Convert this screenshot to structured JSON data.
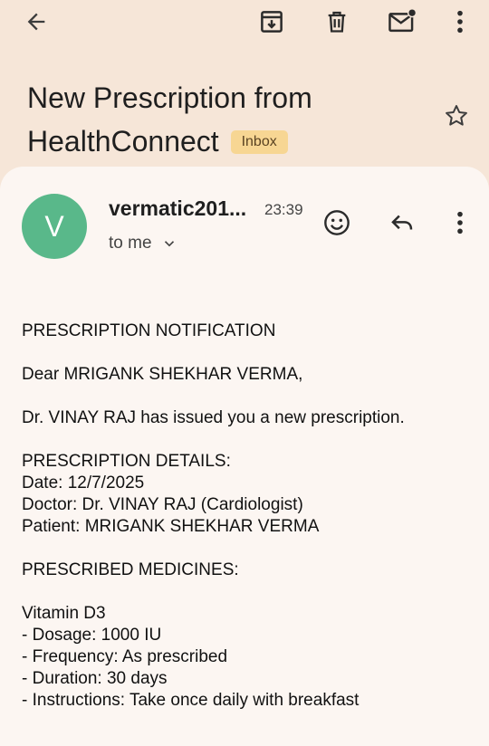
{
  "topbar": {
    "icons": [
      "back-arrow-icon",
      "archive-icon",
      "delete-icon",
      "mark-unread-icon",
      "more-vert-icon"
    ]
  },
  "email": {
    "subject": "New Prescription from HealthConnect",
    "label": "Inbox",
    "sender": {
      "initial": "V",
      "name": "vermatic201...",
      "time": "23:39",
      "recipient": "to me",
      "avatar_color": "#59b88a"
    },
    "body": {
      "heading": "PRESCRIPTION NOTIFICATION",
      "greeting": "Dear MRIGANK SHEKHAR VERMA,",
      "intro": "Dr. VINAY RAJ has issued you a new prescription.",
      "details_heading": "PRESCRIPTION DETAILS:",
      "date": "Date: 12/7/2025",
      "doctor": "Doctor: Dr. VINAY RAJ (Cardiologist)",
      "patient": "Patient: MRIGANK SHEKHAR VERMA",
      "medicines_heading": "PRESCRIBED MEDICINES:",
      "medicine_name": "Vitamin D3",
      "dosage": "- Dosage: 1000 IU",
      "frequency": "- Frequency: As prescribed",
      "duration": "- Duration: 30 days",
      "instructions": "- Instructions: Take once daily with breakfast"
    }
  },
  "colors": {
    "header_bg": "#f6e6d8",
    "card_bg": "#fcf6f2",
    "badge_bg": "#f7d693"
  }
}
